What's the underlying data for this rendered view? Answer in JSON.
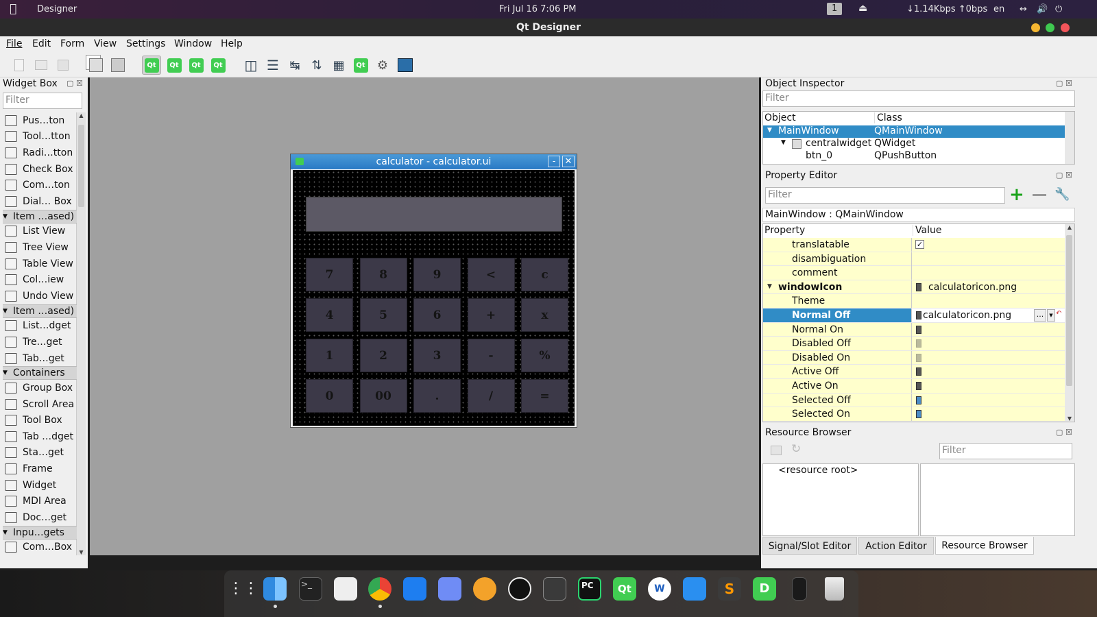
{
  "topbar": {
    "app": "Designer",
    "datetime": "Fri Jul 16   7:06 PM",
    "workspace": "1",
    "net": "↓1.14Kbps ↑0bps",
    "lang": "en"
  },
  "window": {
    "title": "Qt Designer"
  },
  "menu": [
    "File",
    "Edit",
    "Form",
    "View",
    "Settings",
    "Window",
    "Help"
  ],
  "toolbar": {
    "qt_label": "Qt"
  },
  "widget_box": {
    "title": "Widget Box",
    "filter_placeholder": "Filter",
    "items": [
      {
        "t": "item",
        "label": "Pus…ton"
      },
      {
        "t": "item",
        "label": "Tool…tton"
      },
      {
        "t": "item",
        "label": "Radi…tton"
      },
      {
        "t": "item",
        "label": "Check Box"
      },
      {
        "t": "item",
        "label": "Com…ton"
      },
      {
        "t": "item",
        "label": "Dial… Box"
      },
      {
        "t": "cat",
        "label": "Item …ased)"
      },
      {
        "t": "item",
        "label": "List View"
      },
      {
        "t": "item",
        "label": "Tree View"
      },
      {
        "t": "item",
        "label": "Table View"
      },
      {
        "t": "item",
        "label": "Col…iew"
      },
      {
        "t": "item",
        "label": "Undo View"
      },
      {
        "t": "cat",
        "label": "Item …ased)"
      },
      {
        "t": "item",
        "label": "List…dget"
      },
      {
        "t": "item",
        "label": "Tre…get"
      },
      {
        "t": "item",
        "label": "Tab…get"
      },
      {
        "t": "cat",
        "label": "Containers"
      },
      {
        "t": "item",
        "label": "Group Box"
      },
      {
        "t": "item",
        "label": "Scroll Area"
      },
      {
        "t": "item",
        "label": "Tool Box"
      },
      {
        "t": "item",
        "label": "Tab …dget"
      },
      {
        "t": "item",
        "label": "Sta…get"
      },
      {
        "t": "item",
        "label": "Frame"
      },
      {
        "t": "item",
        "label": "Widget"
      },
      {
        "t": "item",
        "label": "MDI Area"
      },
      {
        "t": "item",
        "label": "Doc…get"
      },
      {
        "t": "cat",
        "label": "Inpu…gets"
      },
      {
        "t": "item",
        "label": "Com…Box"
      }
    ]
  },
  "form": {
    "title": "calculator - calculator.ui",
    "min_btn": "-",
    "keys": [
      [
        "7",
        "8",
        "9",
        "<",
        "c"
      ],
      [
        "4",
        "5",
        "6",
        "+",
        "x"
      ],
      [
        "1",
        "2",
        "3",
        "-",
        "%"
      ],
      [
        "0",
        "00",
        ".",
        "/",
        "="
      ]
    ]
  },
  "object_inspector": {
    "title": "Object Inspector",
    "filter_placeholder": "Filter",
    "col_object": "Object",
    "col_class": "Class",
    "rows": [
      {
        "object": "MainWindow",
        "class": "QMainWindow"
      },
      {
        "object": "centralwidget",
        "class": "QWidget"
      },
      {
        "object": "btn_0",
        "class": "QPushButton"
      }
    ]
  },
  "property_editor": {
    "title": "Property Editor",
    "filter_placeholder": "Filter",
    "context": "MainWindow : QMainWindow",
    "col_property": "Property",
    "col_value": "Value",
    "rows": [
      {
        "name": "translatable",
        "value": "",
        "check": true
      },
      {
        "name": "disambiguation",
        "value": ""
      },
      {
        "name": "comment",
        "value": ""
      },
      {
        "name": "windowIcon",
        "value": "calculatoricon.png",
        "bold": true,
        "icon": true
      },
      {
        "name": "Theme",
        "value": ""
      },
      {
        "name": "Normal Off",
        "value": "calculatoricon.png",
        "selected": true,
        "icon": true
      },
      {
        "name": "Normal On",
        "value": "",
        "icon": true
      },
      {
        "name": "Disabled Off",
        "value": "",
        "icon": true
      },
      {
        "name": "Disabled On",
        "value": "",
        "icon": true
      },
      {
        "name": "Active Off",
        "value": "",
        "icon": true
      },
      {
        "name": "Active On",
        "value": "",
        "icon": true
      },
      {
        "name": "Selected Off",
        "value": "",
        "icon": true
      },
      {
        "name": "Selected On",
        "value": "",
        "icon": true
      }
    ],
    "ellipsis": "..."
  },
  "resource_browser": {
    "title": "Resource Browser",
    "filter_placeholder": "Filter",
    "root": "<resource root>"
  },
  "bottom_tabs": [
    "Signal/Slot Editor",
    "Action Editor",
    "Resource Browser"
  ],
  "colors": {
    "selection": "#308cc6",
    "prop_bg": "#ffffcc",
    "qt_green": "#41cd52"
  }
}
